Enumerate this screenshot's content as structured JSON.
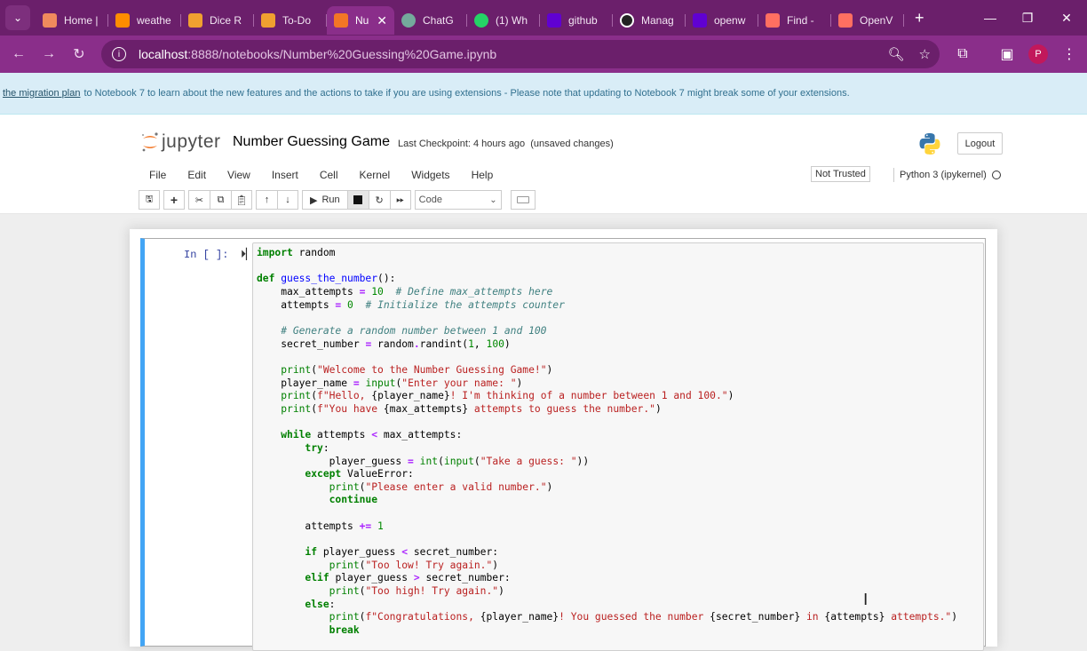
{
  "browser": {
    "tabs": [
      {
        "label": "Home |",
        "icon": "home-icon",
        "color": "#f08a5d"
      },
      {
        "label": "weathe",
        "icon": "weather-icon",
        "color": "#ff8c00"
      },
      {
        "label": "Dice R",
        "icon": "hourglass-icon",
        "color": "#f0a030"
      },
      {
        "label": "To-Do",
        "icon": "hourglass-icon",
        "color": "#f0a030"
      },
      {
        "label": "Nu",
        "icon": "jupyter-icon",
        "color": "#f37626",
        "active": true
      },
      {
        "label": "ChatG",
        "icon": "chatgpt-icon",
        "color": "#74aa9c"
      },
      {
        "label": "(1) Wh",
        "icon": "whatsapp-icon",
        "color": "#25d366"
      },
      {
        "label": "github",
        "icon": "yahoo-icon",
        "color": "#6001d2"
      },
      {
        "label": "Manag",
        "icon": "github-icon",
        "color": "#ffffff"
      },
      {
        "label": "openw",
        "icon": "yahoo-icon",
        "color": "#6001d2"
      },
      {
        "label": "Find -",
        "icon": "brain-icon",
        "color": "#ff6f61"
      },
      {
        "label": "OpenV",
        "icon": "brain-icon",
        "color": "#ff6f61"
      }
    ],
    "url_host": "localhost",
    "url_path": ":8888/notebooks/Number%20Guessing%20Game.ipynb",
    "profile_initial": "P"
  },
  "banner": {
    "link_text": "the migration plan",
    "text": "to Notebook 7 to learn about the new features and the actions to take if you are using extensions - Please note that updating to Notebook 7 might break some of your extensions."
  },
  "header": {
    "logo_text": "jupyter",
    "notebook_title": "Number Guessing Game",
    "checkpoint": "Last Checkpoint: 4 hours ago",
    "unsaved": "(unsaved changes)",
    "logout": "Logout"
  },
  "menu": {
    "items": [
      "File",
      "Edit",
      "View",
      "Insert",
      "Cell",
      "Kernel",
      "Widgets",
      "Help"
    ],
    "trust": "Not Trusted",
    "kernel": "Python 3 (ipykernel)"
  },
  "toolbar": {
    "run_label": "Run",
    "cell_type": "Code"
  },
  "cell": {
    "prompt": "In [ ]:"
  }
}
